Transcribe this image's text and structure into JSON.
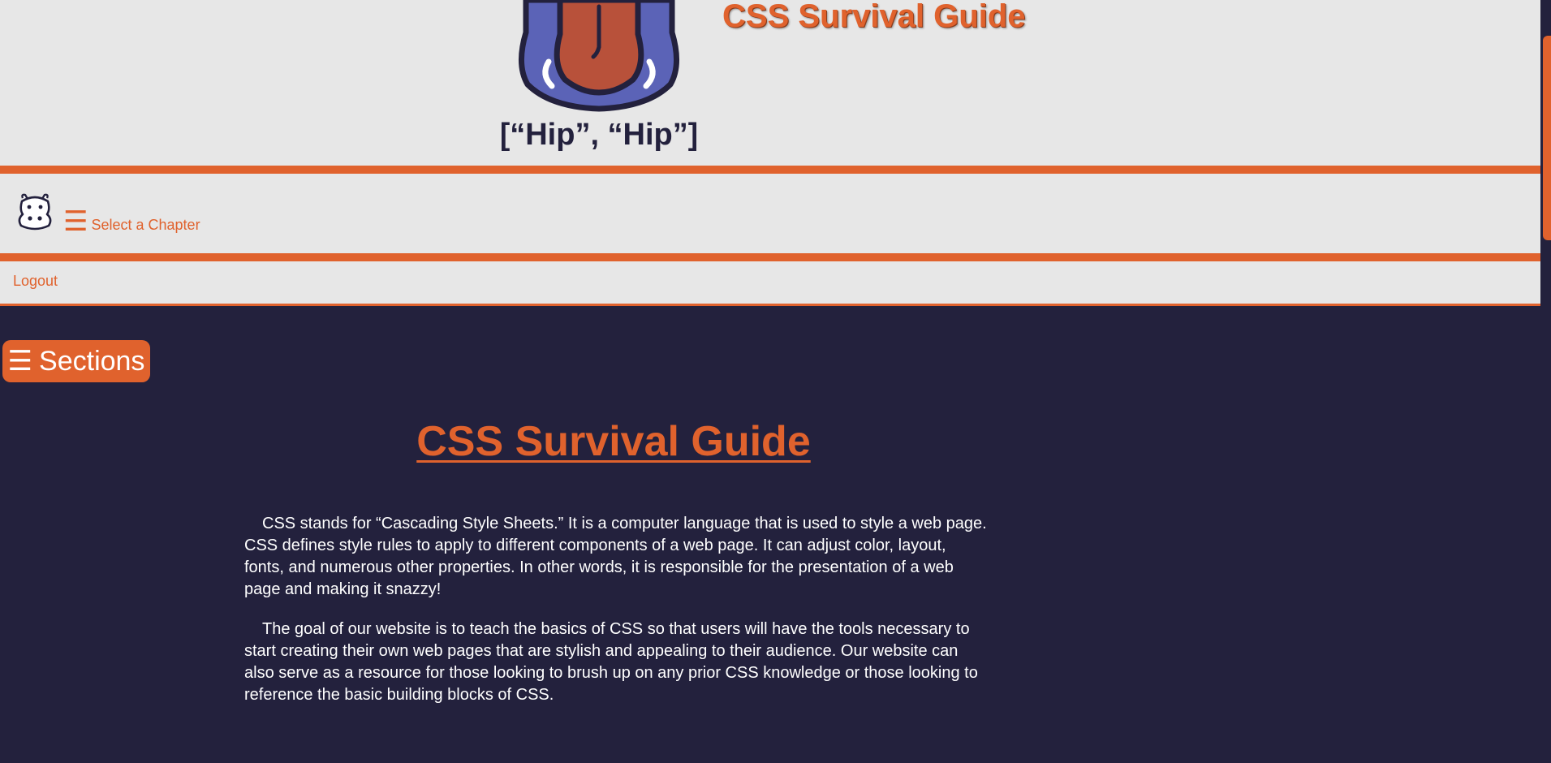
{
  "banner": {
    "logo_caption": "[“Hip”, “Hip”]",
    "site_title": "CSS Survival Guide"
  },
  "chapter_nav": {
    "menu_glyph": "☰",
    "toggle_label": "Select a Chapter",
    "icon": "hippo-face-icon"
  },
  "logout_bar": {
    "logout_label": "Logout"
  },
  "sections_button": {
    "menu_glyph": "☰",
    "label": "Sections"
  },
  "main": {
    "title": "CSS Survival Guide",
    "paragraphs": [
      "CSS stands for “Cascading Style Sheets.” It is a computer language that is used to style a web page. CSS defines style rules to apply to different components of a web page. It can adjust color, layout, fonts, and numerous other properties. In other words, it is responsible for the presentation of a web page and making it snazzy!",
      "The goal of our website is to teach the basics of CSS so that users will have the tools necessary to start creating their own web pages that are stylish and appealing to their audience. Our website can also serve as a resource for those looking to brush up on any prior CSS knowledge or those looking to reference the basic building blocks of CSS."
    ]
  },
  "colors": {
    "accent": "#e0622d",
    "background": "#23213d",
    "panel": "#e7e7e7",
    "logo_blue": "#5b63b7",
    "logo_red": "#b8513a",
    "logo_outline": "#23213d"
  }
}
